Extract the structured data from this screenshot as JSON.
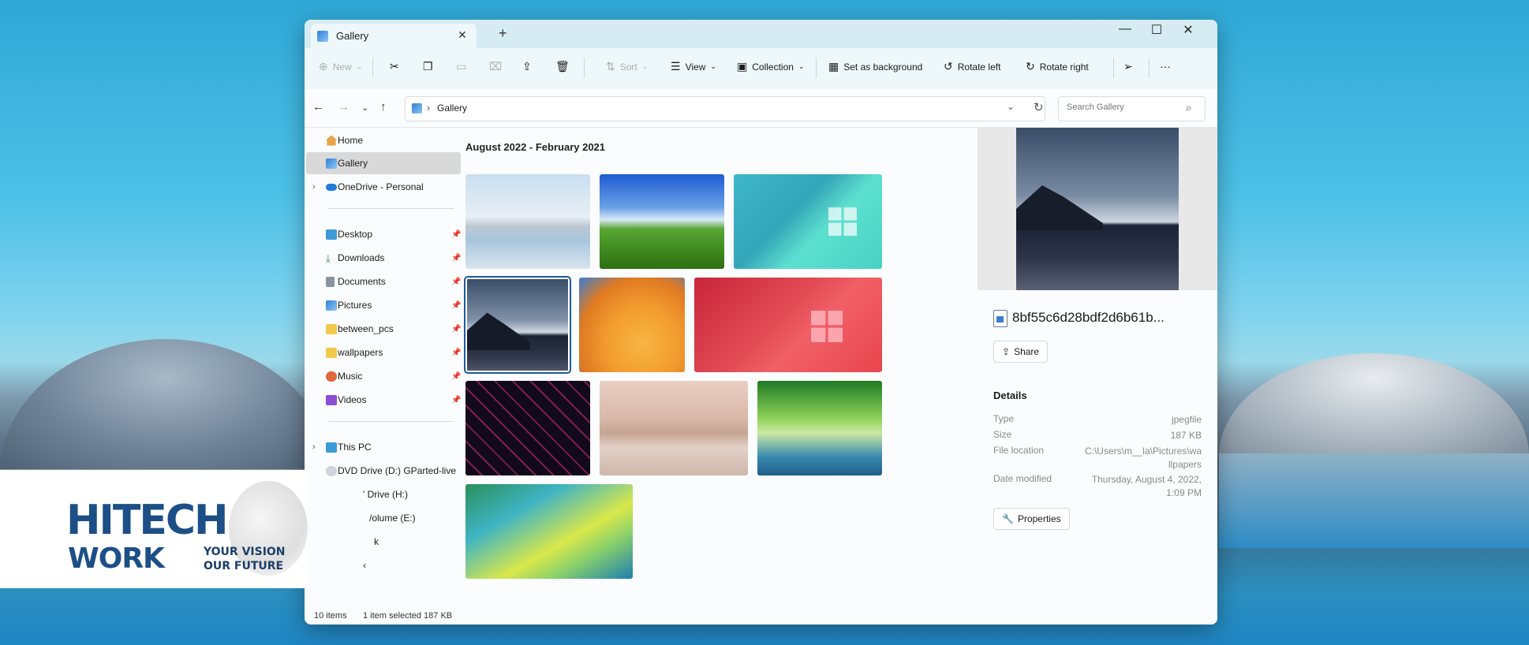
{
  "window": {
    "tab_title": "Gallery",
    "tab_close": "✕",
    "tab_add": "+",
    "minimize": "—",
    "maximize": "☐",
    "close": "✕"
  },
  "toolbar": {
    "new": "New",
    "sort": "Sort",
    "view": "View",
    "collection": "Collection",
    "set_background": "Set as background",
    "rotate_left": "Rotate left",
    "rotate_right": "Rotate right",
    "more": "···"
  },
  "address": {
    "path": "Gallery",
    "search_placeholder": "Search Gallery"
  },
  "sidebar": {
    "items": [
      {
        "label": "Home"
      },
      {
        "label": "Gallery"
      },
      {
        "label": "OneDrive - Personal"
      },
      {
        "label": "Desktop"
      },
      {
        "label": "Downloads"
      },
      {
        "label": "Documents"
      },
      {
        "label": "Pictures"
      },
      {
        "label": "between_pcs"
      },
      {
        "label": "wallpapers"
      },
      {
        "label": "Music"
      },
      {
        "label": "Videos"
      },
      {
        "label": "This PC"
      },
      {
        "label": "DVD Drive (D:) GParted-live"
      },
      {
        "label": "' Drive (H:)"
      },
      {
        "label": "/olume (E:)"
      },
      {
        "label": "k"
      },
      {
        "label": "‹"
      }
    ]
  },
  "content": {
    "group_title": "August 2022 - February 2021"
  },
  "preview": {
    "filename": "8bf55c6d28bdf2d6b61b...",
    "share_label": "Share",
    "details_heading": "Details",
    "details": [
      {
        "key": "Type",
        "value": "jpegfile"
      },
      {
        "key": "Size",
        "value": "187 KB"
      },
      {
        "key": "File location",
        "value": "C:\\Users\\m__la\\Pictures\\wallpapers"
      },
      {
        "key": "Date modified",
        "value": "Thursday, August 4, 2022, 1:09 PM"
      }
    ],
    "properties_label": "Properties"
  },
  "status": {
    "items": "10 items",
    "selection": "1 item selected  187 KB"
  },
  "logo": {
    "line1": "HITECH",
    "line2": "WORK",
    "tagline1": "YOUR VISION",
    "tagline2": "OUR FUTURE"
  },
  "colors": {
    "accent": "#1e5a9a",
    "titlebar": "#d6ecf2",
    "toolbar": "#eef7f9",
    "logo_blue": "#1c4f86"
  }
}
